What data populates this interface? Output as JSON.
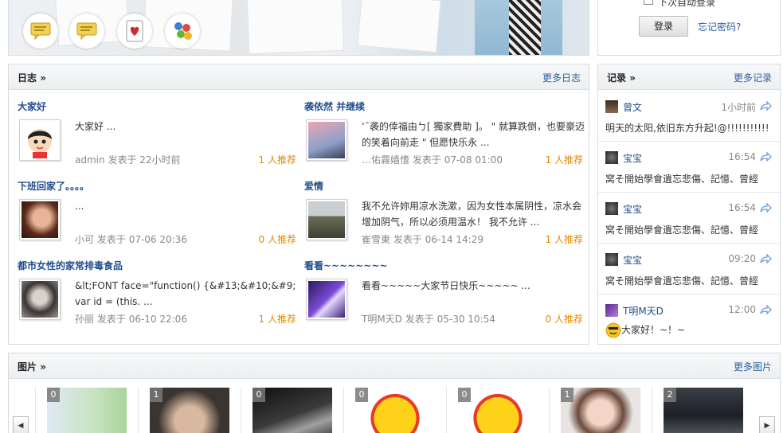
{
  "login": {
    "autologin_label": "下次自动登录",
    "login_button": "登录",
    "forgot_link": "忘记密码?"
  },
  "blog": {
    "title": "日志",
    "more": "更多日志",
    "entries": [
      {
        "title": "大家好",
        "summary": "大家好 ...",
        "author": "admin",
        "posted_word": "发表于",
        "time": "22小时前",
        "recommend": "1 人推荐"
      },
      {
        "title": "袭依然  并继续",
        "summary": "‘¯袭的倖福由ㄅ[ 獨家費助 ]。 \" 就算跌倒，也要豪迈的笑着向前走 \" 但愿快乐永 ...",
        "author": "…佑霧嫱愭",
        "posted_word": "发表于",
        "time": "07-08 01:00",
        "recommend": "1 人推荐"
      },
      {
        "title": "下班回家了。。。。",
        "summary": "...",
        "author": "小可",
        "posted_word": "发表于",
        "time": "07-06 20:36",
        "recommend": "0 人推荐"
      },
      {
        "title": "爱情",
        "summary": "我不允许妳用凉水洗漱，因为女性本属阴性，凉水会增加阴气，所以必须用温水！ 我不允许 ...",
        "author": "崔雪東",
        "posted_word": "发表于",
        "time": "06-14 14:29",
        "recommend": "1 人推荐"
      },
      {
        "title": "都市女性的家常排毒食品",
        "summary": "&lt;FONT face=\"function() {&#13;&#10;&#9;var id = (this. ...",
        "author": "孙丽",
        "posted_word": "发表于",
        "time": "06-10 22:06",
        "recommend": "1 人推荐"
      },
      {
        "title": "看看~~~~~~~~",
        "summary": "看看~~~~~大家节日快乐~~~~~ ...",
        "author": "T明M天D",
        "posted_word": "发表于",
        "time": "05-30 10:54",
        "recommend": "0 人推荐"
      }
    ]
  },
  "records": {
    "title": "记录",
    "more": "更多记录",
    "items": [
      {
        "name": "曾文",
        "time": "1小时前",
        "text": "明天的太阳,依旧东方升起!@!!!!!!!!!!!"
      },
      {
        "name": "宝宝",
        "time": "16:54",
        "text": "窝そ開始學會遺忘悲傷、記憶、曾經"
      },
      {
        "name": "宝宝",
        "time": "16:54",
        "text": "窝そ開始學會遺忘悲傷、記憶、曾經"
      },
      {
        "name": "宝宝",
        "time": "09:20",
        "text": "窝そ開始學會遺忘悲傷、記憶、曾經"
      },
      {
        "name": "T明M天D",
        "time": "12:00",
        "text": "大家好！~！~"
      }
    ]
  },
  "photos": {
    "title": "图片",
    "more": "更多图片",
    "items": [
      {
        "count": "0"
      },
      {
        "count": "1"
      },
      {
        "count": "0"
      },
      {
        "count": "0"
      },
      {
        "count": "0"
      },
      {
        "count": "1"
      },
      {
        "count": "2"
      }
    ]
  },
  "colors": {
    "link": "#1f4e8c",
    "recommend": "#e08a00",
    "meta": "#888888"
  }
}
